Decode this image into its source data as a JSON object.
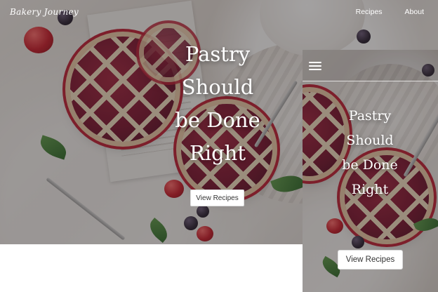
{
  "desktop": {
    "brand": "Bakery Journey",
    "nav": [
      {
        "label": "Recipes"
      },
      {
        "label": "About"
      }
    ],
    "hero": {
      "title_lines": [
        "Pastry",
        "Should",
        "be Done",
        "Right"
      ],
      "cta_label": "View Recipes"
    }
  },
  "mobile": {
    "menu_icon": "hamburger-menu-icon",
    "hero": {
      "title_lines": [
        "Pastry",
        "Should",
        "be Done",
        "Right"
      ],
      "cta_label": "View Recipes"
    }
  },
  "colors": {
    "overlay": "#231e1e",
    "text": "#ffffff",
    "button_bg": "#ffffff",
    "button_text": "#333333"
  }
}
